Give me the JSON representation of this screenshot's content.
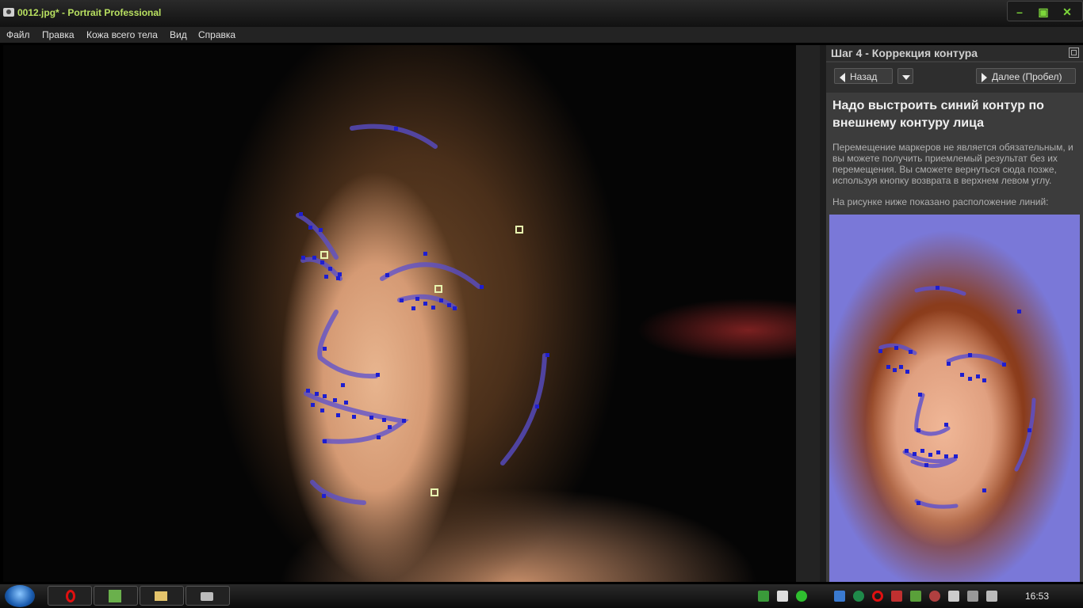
{
  "window": {
    "title": "0012.jpg* - Portrait Professional"
  },
  "window_buttons": {
    "minimize": "–",
    "restore": "▣",
    "close": "✕"
  },
  "menu": [
    "Файл",
    "Правка",
    "Кожа всего тела",
    "Вид",
    "Справка"
  ],
  "panel": {
    "title": "Шаг 4 - Коррекция контура",
    "back_label": "Назад",
    "next_label": "Далее (Пробел)",
    "heading": "Надо выстроить синий контур по внешнему контуру лица",
    "description": "Перемещение маркеров не является обязательным, и вы можете получить приемлемый результат без их перемещения. Вы сможете вернуться сюда позже, используя кнопку возврата в верхнем левом углу.",
    "description2": "На рисунке ниже показано расположение линий:"
  },
  "colors": {
    "contour": "#5a4fd0",
    "marker": "#1e1ed0",
    "handle": "#e8f5b0",
    "title_green": "#b8e060"
  },
  "taskbar": {
    "buttons": [
      "opera-icon",
      "download-icon",
      "folder-icon",
      "camera-icon"
    ],
    "clock": "16:53"
  }
}
